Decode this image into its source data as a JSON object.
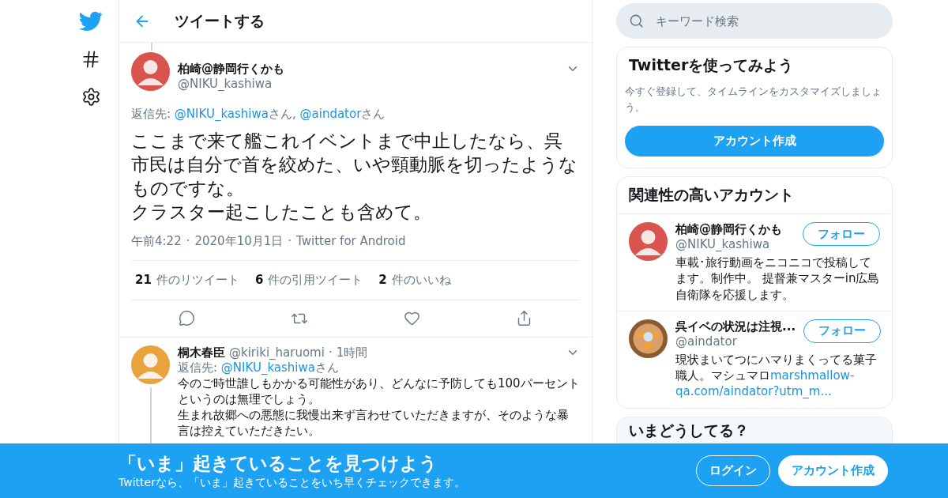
{
  "header": {
    "title": "ツイートする"
  },
  "search": {
    "placeholder": "キーワード検索"
  },
  "tweet": {
    "name": "柏崎@静岡行くかも",
    "handle": "@NIKU_kashiwa",
    "reply_prefix": "返信先:",
    "reply_to": [
      {
        "handle": "@NIKU_kashiwa",
        "suffix": "さん,"
      },
      {
        "handle": "@aindator",
        "suffix": "さん"
      }
    ],
    "paragraphs": [
      "ここまで来て艦これイベントまで中止したなら、呉市民は自分で首を絞めた、いや頸動脈を切ったようなものですな。",
      "クラスター起こしたことも含めて。"
    ],
    "meta_separator": "·",
    "meta": [
      "午前4:22",
      "2020年10月1日",
      "Twitter for Android"
    ],
    "stats": [
      {
        "count": "21",
        "label": "件のリツイート"
      },
      {
        "count": "6",
        "label": "件の引用ツイート"
      },
      {
        "count": "2",
        "label": "件のいいね"
      }
    ]
  },
  "replies": [
    {
      "name": "桐木春臣",
      "handle": "@kiriki_haruomi",
      "separator": "·",
      "time": "1時間",
      "reply_prefix": "返信先:",
      "reply_to": [
        {
          "handle": "@NIKU_kashiwa",
          "suffix": "さん"
        }
      ],
      "paragraphs": [
        "今のご時世誰しもかかる可能性があり、どんなに予防しても100パーセントというのは無理でしょう。",
        "生まれ故郷への悪態に我慢出来ず言わせていただきますが、そのような暴言は控えていただきたい。"
      ]
    }
  ],
  "signup_card": {
    "title": "Twitterを使ってみよう",
    "text": "今すぐ登録して、タイムラインをカスタマイズしましょう。",
    "button": "アカウント作成"
  },
  "related": {
    "title": "関連性の高いアカウント",
    "accounts": [
      {
        "kind": "character",
        "name": "柏崎@静岡行くかも",
        "handle": "@NIKU_kashiwa",
        "button": "フォロー",
        "bio": "車載･旅行動画をニコニコで投稿してます。制作中。 提督兼マスターin広島自衛隊を応援します。"
      },
      {
        "kind": "picture",
        "name": "呉イベの状況は注視...",
        "handle": "@aindator",
        "button": "フォロー",
        "bio": "現状まいてつにハマりまくってる菓子職人。マシュマロ",
        "bio_links": [
          "marshmallow-",
          "qa.com/aindator?utm_m..."
        ]
      }
    ]
  },
  "trends": {
    "title": "いまどうしてる？"
  },
  "bottom_bar": {
    "title": "「いま」起きていることを見つけよう",
    "subtitle": "Twitterなら、「いま」起きていることをいち早くチェックできます。",
    "login": "ログイン",
    "signup": "アカウント作成"
  }
}
